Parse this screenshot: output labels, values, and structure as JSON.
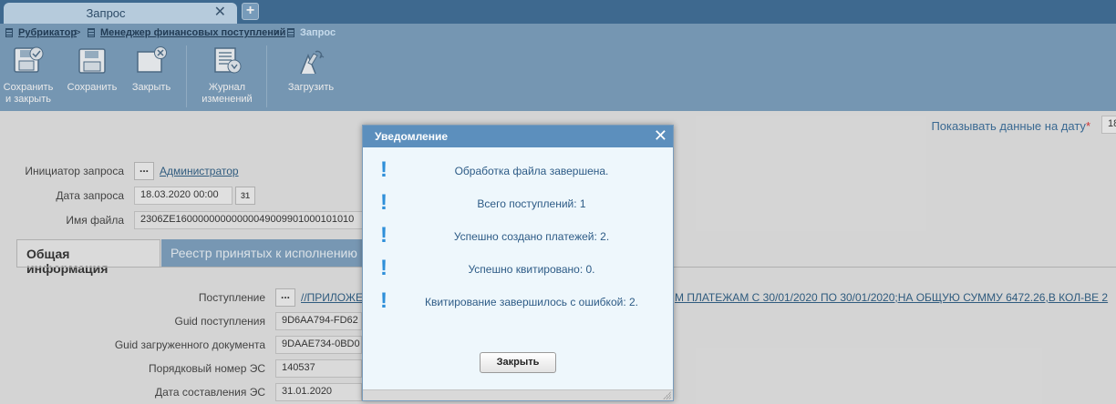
{
  "window": {
    "tab_title": "Запрос",
    "tab_close": "✕",
    "tab_add": "+"
  },
  "breadcrumb": {
    "items": [
      "Рубрикатор",
      "Менеджер финансовых поступлений",
      "Запрос"
    ],
    "separator": ">"
  },
  "toolbar": {
    "save_close_line1": "Сохранить",
    "save_close_line2": "и закрыть",
    "save": "Сохранить",
    "close": "Закрыть",
    "journal_line1": "Журнал",
    "journal_line2": "изменений",
    "upload": "Загрузить"
  },
  "date_filter": {
    "label": "Показывать данные на дату",
    "required_mark": "*",
    "value": "18"
  },
  "form": {
    "initiator_label": "Инициатор запроса",
    "initiator_value": "Администратор",
    "request_date_label": "Дата запроса",
    "request_date_value": "18.03.2020 00:00",
    "calendar_icon_text": "31",
    "file_name_label": "Имя файла",
    "file_name_value": "2306ZE16000000000000049009901000101010",
    "dots": "..."
  },
  "tabs": {
    "general": "Общая информация",
    "registry": "Реестр принятых к исполнению"
  },
  "details": {
    "income_label": "Поступление",
    "income_value_left": "//ПРИЛОЖЕ",
    "income_value_right": "М ПЛАТЕЖАМ С 30/01/2020 ПО 30/01/2020;НА ОБЩУЮ СУММУ 6472.26,В КОЛ-ВЕ 2",
    "guid_income_label": "Guid поступления",
    "guid_income_value": "9D6AA794-FD62",
    "guid_doc_label": "Guid загруженного документа",
    "guid_doc_value": "9DAAE734-0BD0",
    "serial_label": "Порядковый номер ЭС",
    "serial_value": "140537",
    "compose_date_label": "Дата составления ЭС",
    "compose_date_value": "31.01.2020"
  },
  "modal": {
    "title": "Уведомление",
    "close_icon": "✕",
    "messages": [
      "Обработка файла завершена.",
      "Всего поступлений: 1",
      "Успешно создано платежей: 2.",
      "Успешно квитировано: 0.",
      "Квитирование завершилось с ошибкой: 2."
    ],
    "exclamation": "!",
    "close_button": "Закрыть"
  },
  "colors": {
    "header": "#3f6f99",
    "toolbar": "#7ca1c0",
    "modal_header": "#5c8fbd",
    "modal_body": "#eef7fc",
    "accent_icon": "#2e8fd9"
  }
}
